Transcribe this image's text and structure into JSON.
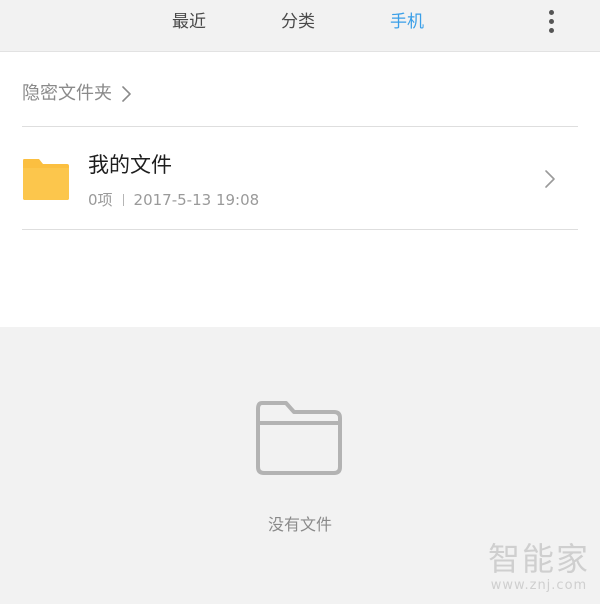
{
  "tabs": [
    {
      "label": "最近",
      "active": false
    },
    {
      "label": "分类",
      "active": false
    },
    {
      "label": "手机",
      "active": true
    }
  ],
  "more_icon": "more-vertical-icon",
  "hidden_folder": {
    "label": "隐密文件夹",
    "icon": "chevron-right-icon"
  },
  "folder": {
    "name": "我的文件",
    "count": "0项",
    "date": "2017-5-13 19:08",
    "icon": "folder-icon",
    "icon_color": "#fbbf40"
  },
  "empty_state": {
    "icon": "empty-folder-icon",
    "text": "没有文件"
  },
  "watermark": {
    "logo": "智能家",
    "url": "www.znj.com"
  },
  "colors": {
    "accent": "#3a9fe8",
    "topbar_bg": "#f2f2f2",
    "empty_bg": "#f2f2f2"
  }
}
